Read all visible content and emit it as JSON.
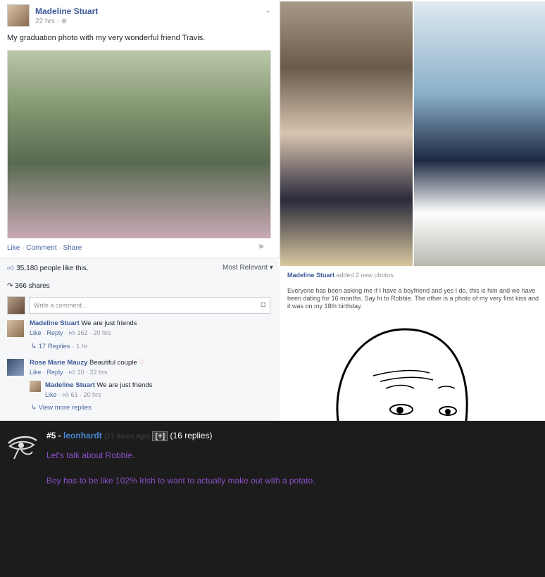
{
  "post": {
    "author": "Madeline Stuart",
    "time": "22 hrs",
    "caption": "My graduation photo with my very wonderful friend Travis.",
    "actions": [
      "Like",
      "Comment",
      "Share"
    ],
    "likes": "35,180 people like this.",
    "sort": "Most Relevant",
    "shares": "366 shares",
    "comment_placeholder": "Write a comment..."
  },
  "comments": [
    {
      "name": "Madeline Stuart",
      "text": "We are just friends",
      "likes": "162",
      "time": "20 hrs",
      "replies": "17 Replies",
      "replies_time": "1 hr"
    },
    {
      "name": "Rose Marie Mauzy",
      "text": "Beautiful couple",
      "likes": "10",
      "time": "22 hrs",
      "reply": {
        "name": "Madeline Stuart",
        "text": "We are just friends",
        "likes": "61",
        "time": "20 hrs"
      },
      "more": "View more replies"
    }
  ],
  "comment_actions": {
    "like": "Like",
    "reply": "Reply"
  },
  "second_post": {
    "header_name": "Madeline Stuart",
    "header_rest": "added 2 new photos.",
    "body": "Everyone has been asking me if I have a boyfriend and yes I do, this is him and we have been dating for 16 months. Say hi to Robbie. The other is a photo of my very first kiss and it was on my 18th birthday."
  },
  "forum": {
    "number": "#5 -",
    "user": "leonhardt",
    "ago": "(21 hours ago)",
    "expand": "[+]",
    "replies": "(16 replies)",
    "line1": "Let's talk about Robbie.",
    "line2": "Boy has to be like 102% Irish to want to actually make out with a potato."
  },
  "colors": {
    "link": "#3b5998",
    "forum_bg": "#1c1c1c",
    "forum_text": "#8a4fc7",
    "forum_user": "#4a88d4"
  }
}
